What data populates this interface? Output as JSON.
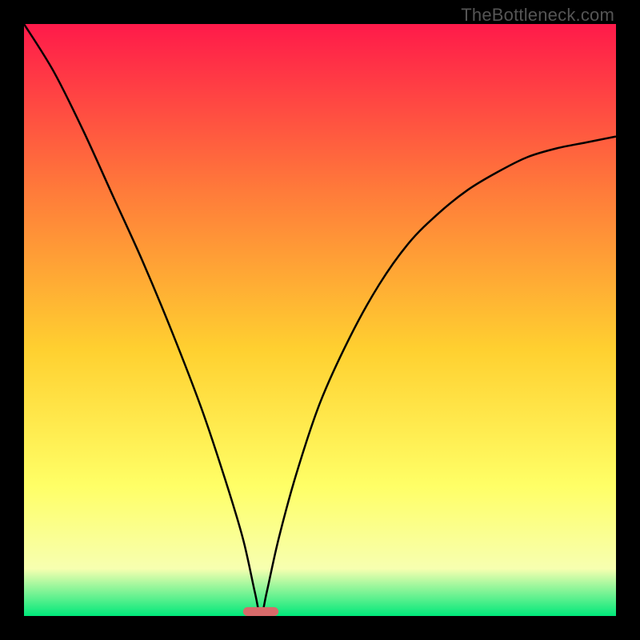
{
  "watermark": "TheBottleneck.com",
  "colors": {
    "frame": "#000000",
    "gradient_top": "#ff1a4a",
    "gradient_upper_mid": "#ff7a3a",
    "gradient_mid": "#ffd030",
    "gradient_lower_mid": "#ffff66",
    "gradient_low": "#f7ffb0",
    "gradient_bottom": "#00e87a",
    "curve": "#000000",
    "marker": "#d86a6a"
  },
  "chart_data": {
    "type": "line",
    "title": "",
    "xlabel": "",
    "ylabel": "",
    "xlim": [
      0,
      100
    ],
    "ylim": [
      0,
      100
    ],
    "minimum_x": 40,
    "marker": {
      "x": 40,
      "y": 0,
      "width": 6,
      "height": 1.5
    },
    "series": [
      {
        "name": "bottleneck-curve",
        "x": [
          0,
          5,
          10,
          15,
          20,
          25,
          30,
          34,
          37,
          39,
          40,
          41,
          43,
          46,
          50,
          55,
          60,
          65,
          70,
          75,
          80,
          85,
          90,
          95,
          100
        ],
        "values": [
          100,
          92,
          82,
          71,
          60,
          48,
          35,
          23,
          13,
          4,
          0,
          4,
          13,
          24,
          36,
          47,
          56,
          63,
          68,
          72,
          75,
          77.5,
          79,
          80,
          81
        ]
      }
    ]
  }
}
